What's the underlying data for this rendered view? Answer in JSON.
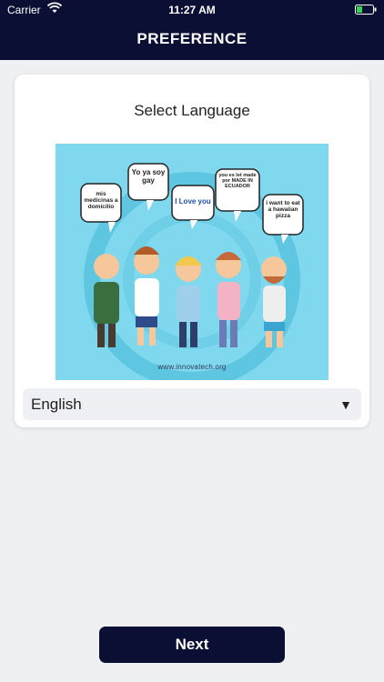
{
  "status_bar": {
    "carrier": "Carrier",
    "time": "11:27 AM"
  },
  "header": {
    "title": "PREFERENCE"
  },
  "card": {
    "title": "Select Language",
    "image": {
      "bubbles": [
        "mis medicinas a domicilio",
        "Yo ya soy gay",
        "I Love you",
        "you es let made por MADE IN ECUADOR",
        "i want to eat a hawaiian pizza"
      ],
      "caption": "www.innovatech.org"
    }
  },
  "language_select": {
    "selected": "English",
    "arrow_icon": "dropdown-triangle-icon"
  },
  "next_button": {
    "label": "Next"
  },
  "colors": {
    "header_bg": "#0b0f33",
    "page_bg": "#eff0f2",
    "illustration_bg": "#7fd8ee",
    "button_bg": "#0b0f33"
  }
}
